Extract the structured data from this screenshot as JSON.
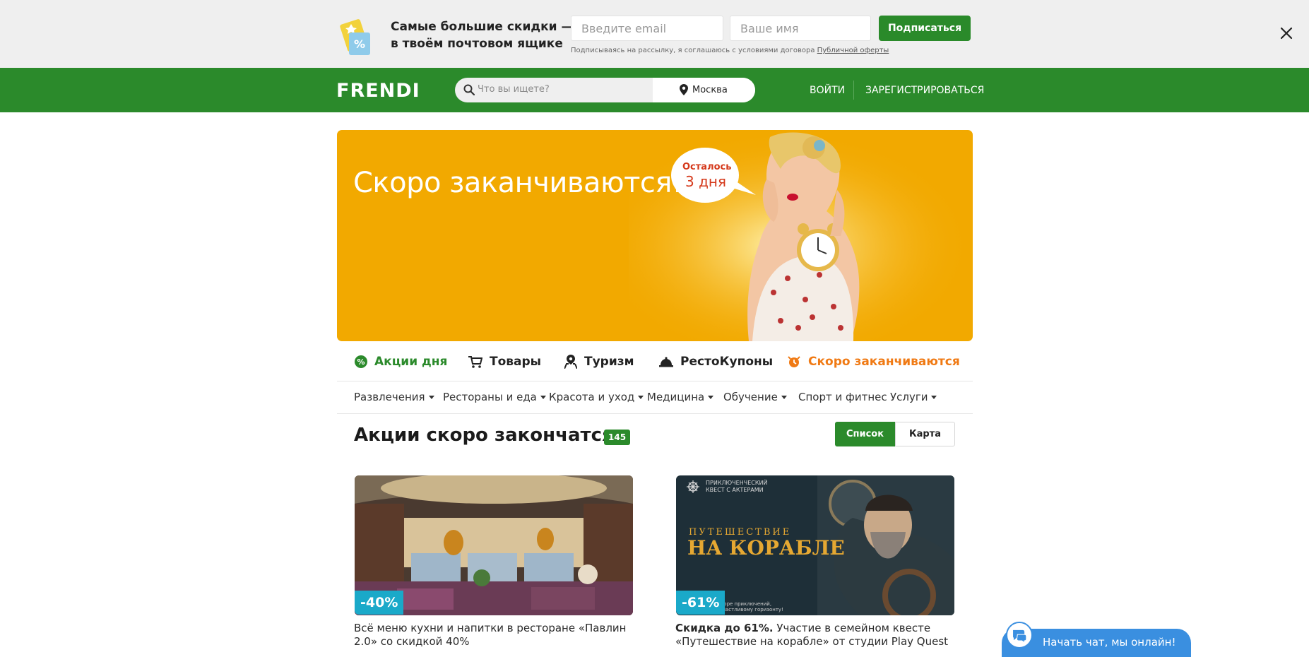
{
  "subscribe": {
    "title_line1": "Самые большие скидки —",
    "title_line2": "в твоём почтовом ящике",
    "email_placeholder": "Введите email",
    "name_placeholder": "Ваше имя",
    "button": "Подписаться",
    "note_prefix": "Подписываясь на рассылку, я соглашаюсь с условиями договора ",
    "note_link": "Публичной оферты"
  },
  "header": {
    "logo": "FRENDI",
    "search_placeholder": "Что вы ищете?",
    "city": "Москва",
    "login": "ВОЙТИ",
    "register": "ЗАРЕГИСТРИРОВАТЬСЯ",
    "brand_color": "#2b8a2b"
  },
  "hero": {
    "title": "Скоро заканчиваются!",
    "bubble_line1": "Осталось",
    "bubble_line2": "3 дня",
    "bg_color": "#f2a900"
  },
  "categories": [
    {
      "label": "Акции дня",
      "icon": "percent-icon"
    },
    {
      "label": "Товары",
      "icon": "cart-icon"
    },
    {
      "label": "Туризм",
      "icon": "map-pin-icon"
    },
    {
      "label": "РестоКупоны",
      "icon": "cloche-icon"
    },
    {
      "label": "Скоро заканчиваются",
      "icon": "alarm-icon"
    }
  ],
  "subcategories": [
    {
      "label": "Развлечения",
      "dropdown": true
    },
    {
      "label": "Рестораны и еда",
      "dropdown": true
    },
    {
      "label": "Красота и уход",
      "dropdown": true
    },
    {
      "label": "Медицина",
      "dropdown": true
    },
    {
      "label": "Обучение",
      "dropdown": true
    },
    {
      "label": "Спорт и фитнес",
      "dropdown": false
    },
    {
      "label": "Услуги",
      "dropdown": true
    }
  ],
  "section": {
    "title": "Акции скоро закончатся",
    "count": "145",
    "view_list": "Список",
    "view_map": "Карта"
  },
  "cards": [
    {
      "discount": "-40%",
      "text": "Всё меню кухни и напитки в ресторане «Павлин 2.0» со скидкой 40%",
      "bold_prefix": ""
    },
    {
      "discount": "-61%",
      "bold_prefix": "Скидка до 61%.",
      "text": " Участие в семейном квесте «Путешествие на корабле» от студии Play Quest",
      "img_caption_top": "ПРИКЛЮЧЕНЧЕСКИЙ",
      "img_caption_top2": "КВЕСТ С АКТЕРАМИ",
      "img_title1": "ПУТЕШЕСТВИЕ",
      "img_title2": "НА КОРАБЛЕ",
      "img_small1": "море приключений,",
      "img_small2": "счастливому горизонту!"
    }
  ],
  "chat": {
    "label": "Начать чат, мы онлайн!"
  }
}
